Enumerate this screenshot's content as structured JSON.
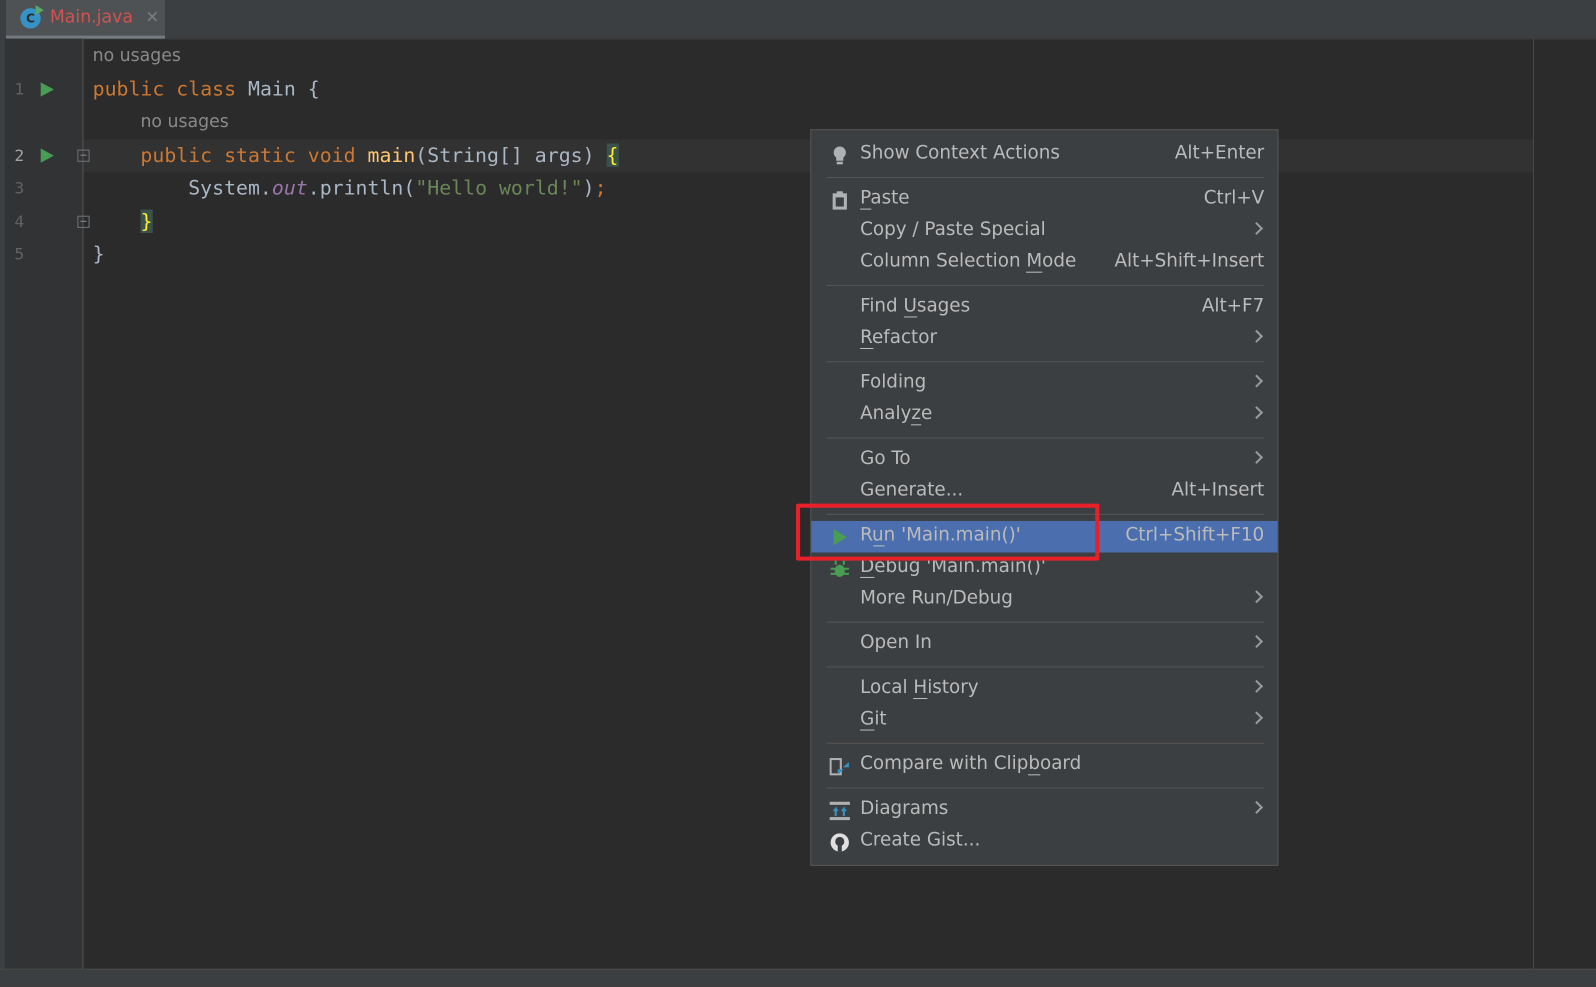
{
  "tab": {
    "filename": "Main.java",
    "icon": "java-class-icon",
    "close": "✕",
    "icon_letter": "C"
  },
  "editor": {
    "hints": [
      "no usages",
      "no usages"
    ],
    "line_numbers": [
      "1",
      "2",
      "3",
      "4",
      "5"
    ],
    "lines": [
      [
        {
          "t": "public ",
          "k": "kw"
        },
        {
          "t": "class ",
          "k": "kw"
        },
        {
          "t": "Main ",
          "k": ""
        },
        {
          "t": "{",
          "k": ""
        }
      ],
      [
        {
          "t": "    public ",
          "k": "kw"
        },
        {
          "t": "static ",
          "k": "kw"
        },
        {
          "t": "void ",
          "k": "kw"
        },
        {
          "t": "main",
          "k": "fn"
        },
        {
          "t": "(String[] args) ",
          "k": ""
        },
        {
          "t": "{",
          "k": "brace"
        }
      ],
      [
        {
          "t": "        System.",
          "k": ""
        },
        {
          "t": "out",
          "k": "field"
        },
        {
          "t": ".println(",
          "k": ""
        },
        {
          "t": "\"Hello world!\"",
          "k": "str"
        },
        {
          "t": ")",
          "k": ""
        },
        {
          "t": ";",
          "k": "punct"
        }
      ],
      [
        {
          "t": "    ",
          "k": ""
        },
        {
          "t": "}",
          "k": "brace"
        }
      ],
      [
        {
          "t": "}",
          "k": ""
        }
      ]
    ]
  },
  "context_menu": {
    "highlight_color": "#4b6eaf",
    "items": [
      {
        "label": "Show Context Actions",
        "shortcut": "Alt+Enter",
        "icon": "lightbulb-icon",
        "m": -1
      },
      {
        "sep": true
      },
      {
        "label": "Paste",
        "shortcut": "Ctrl+V",
        "icon": "clipboard-icon",
        "m": 0
      },
      {
        "label": "Copy / Paste Special",
        "submenu": true,
        "m": -1
      },
      {
        "label": "Column Selection Mode",
        "shortcut": "Alt+Shift+Insert",
        "m": 17
      },
      {
        "sep": true
      },
      {
        "label": "Find Usages",
        "shortcut": "Alt+F7",
        "m": 5
      },
      {
        "label": "Refactor",
        "submenu": true,
        "m": 0
      },
      {
        "sep": true
      },
      {
        "label": "Folding",
        "submenu": true,
        "m": -1
      },
      {
        "label": "Analyze",
        "submenu": true,
        "m": 5
      },
      {
        "sep": true
      },
      {
        "label": "Go To",
        "submenu": true,
        "m": -1
      },
      {
        "label": "Generate...",
        "shortcut": "Alt+Insert",
        "m": -1
      },
      {
        "sep": true
      },
      {
        "label": "Run 'Main.main()'",
        "shortcut": "Ctrl+Shift+F10",
        "icon": "run-icon",
        "m": 1,
        "selected": true
      },
      {
        "label": "Debug 'Main.main()'",
        "icon": "debug-bug-icon",
        "m": 0
      },
      {
        "label": "More Run/Debug",
        "submenu": true,
        "m": -1
      },
      {
        "sep": true
      },
      {
        "label": "Open In",
        "submenu": true,
        "m": -1
      },
      {
        "sep": true
      },
      {
        "label": "Local History",
        "submenu": true,
        "m": 6
      },
      {
        "label": "Git",
        "submenu": true,
        "m": 0
      },
      {
        "sep": true
      },
      {
        "label": "Compare with Clipboard",
        "icon": "compare-clipboard-icon",
        "m": 17
      },
      {
        "sep": true
      },
      {
        "label": "Diagrams",
        "submenu": true,
        "icon": "diagrams-icon",
        "m": -1
      },
      {
        "label": "Create Gist...",
        "icon": "github-icon",
        "m": -1
      }
    ]
  }
}
